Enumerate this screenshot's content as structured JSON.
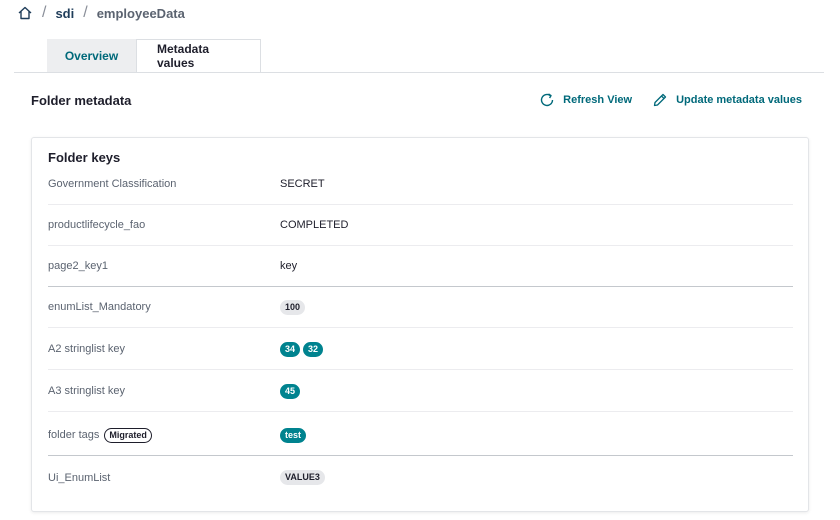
{
  "breadcrumb": {
    "home_icon": "home-icon",
    "items": [
      "sdi",
      "employeeData"
    ],
    "separator": "/"
  },
  "tabs": [
    {
      "label": "Overview",
      "active": false
    },
    {
      "label": "Metadata values",
      "active": true
    }
  ],
  "section": {
    "title": "Folder metadata"
  },
  "actions": {
    "refresh": {
      "label": "Refresh View",
      "icon": "refresh-icon"
    },
    "update": {
      "label": "Update metadata values",
      "icon": "pencil-icon"
    }
  },
  "card": {
    "title": "Folder keys",
    "rows": [
      {
        "key": "Government Classification",
        "value": "SECRET"
      },
      {
        "key": "productlifecycle_fao",
        "value": "COMPLETED"
      },
      {
        "key": "page2_key1",
        "value": "key"
      },
      {
        "key": "enumList_Mandatory",
        "pills": [
          "100"
        ]
      },
      {
        "key": "A2 stringlist key",
        "pills": [
          "34",
          "32"
        ]
      },
      {
        "key": "A3 stringlist key",
        "pills": [
          "45"
        ]
      },
      {
        "key": "folder tags",
        "badge": "Migrated",
        "pills": [
          "test"
        ]
      },
      {
        "key": "Ui_EnumList",
        "pills": [
          "VALUE3"
        ]
      }
    ]
  },
  "colors": {
    "accent": "#00697a",
    "pill_teal": "#00838f",
    "pill_gray": "#e6e7ea"
  }
}
